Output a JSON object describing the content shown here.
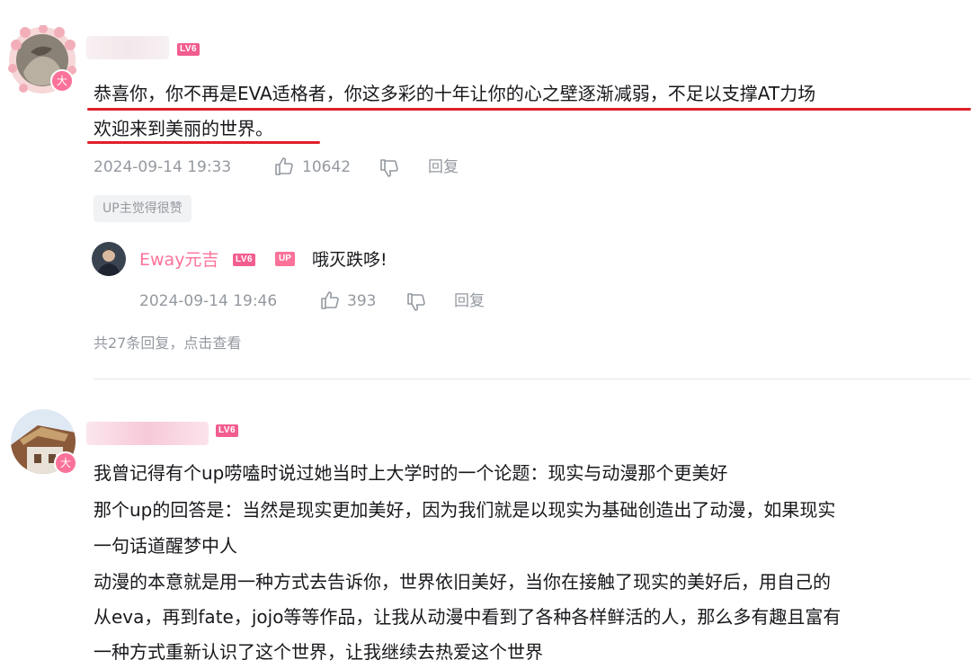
{
  "comment1": {
    "level_badge": "LV6",
    "vip_badge": "大",
    "text_line1": "恭喜你，你不再是EVA适格者，你这多彩的十年让你的心之壁逐渐减弱，不足以支撑AT力场",
    "text_line2": "欢迎来到美丽的世界。",
    "time": "2024-09-14 19:33",
    "likes": "10642",
    "reply_label": "回复",
    "up_liked_tag": "UP主觉得很赞",
    "highlight_color": "#e0202a"
  },
  "reply1": {
    "username": "Eway元吉",
    "level_badge": "LV6",
    "up_badge": "UP",
    "text": "哦灭跌哆!",
    "time": "2024-09-14 19:46",
    "likes": "393",
    "reply_label": "回复"
  },
  "replies_summary": "共27条回复，点击查看",
  "comment2": {
    "level_badge": "LV6",
    "vip_badge": "大",
    "lines": [
      "我曾记得有个up唠嗑时说过她当时上大学时的一个论题：现实与动漫那个更美好",
      "那个up的回答是：当然是现实更加美好，因为我们就是以现实为基础创造出了动漫，如果现实",
      "一句话道醒梦中人",
      "动漫的本意就是用一种方式去告诉你，世界依旧美好，当你在接触了现实的美好后，用自己的",
      "从eva，再到fate，jojo等等作品，让我从动漫中看到了各种各样鲜活的人，那么多有趣且富有",
      "一种方式重新认识了这个世界，让我继续去热爱这个世界"
    ]
  },
  "icons": [
    "thumbs-up-icon",
    "thumbs-down-icon"
  ],
  "colors": {
    "username_pink": "#fb7299",
    "level_badge": "#f25d8e",
    "meta_gray": "#9499a0"
  }
}
